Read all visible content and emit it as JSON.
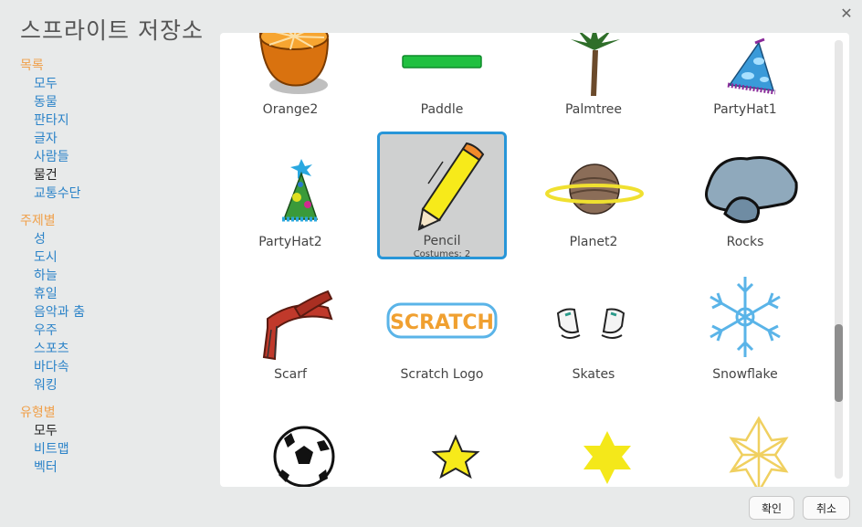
{
  "dialog": {
    "title": "스프라이트 저장소",
    "close_glyph": "✕"
  },
  "sidebar": {
    "category_header": "목록",
    "category_items": [
      "모두",
      "동물",
      "판타지",
      "글자",
      "사람들",
      "물건",
      "교통수단"
    ],
    "theme_header": "주제별",
    "theme_items": [
      "성",
      "도시",
      "하늘",
      "휴일",
      "음악과 춤",
      "우주",
      "스포츠",
      "바다속",
      "워킹"
    ],
    "type_header": "유형별",
    "type_items": [
      "모두",
      "비트맵",
      "벡터"
    ],
    "selected_category": "물건",
    "selected_type": "모두"
  },
  "sprites": [
    {
      "name": "Orange2",
      "icon": "orange-icon"
    },
    {
      "name": "Paddle",
      "icon": "paddle-icon"
    },
    {
      "name": "Palmtree",
      "icon": "palmtree-icon"
    },
    {
      "name": "PartyHat1",
      "icon": "party-hat-icon"
    },
    {
      "name": "PartyHat2",
      "icon": "party-hat-icon"
    },
    {
      "name": "Pencil",
      "icon": "pencil-icon",
      "costumes": "Costumes: 2",
      "selected": true
    },
    {
      "name": "Planet2",
      "icon": "planet-icon"
    },
    {
      "name": "Rocks",
      "icon": "rocks-icon"
    },
    {
      "name": "Scarf",
      "icon": "scarf-icon"
    },
    {
      "name": "Scratch Logo",
      "icon": "scratch-logo-icon"
    },
    {
      "name": "Skates",
      "icon": "skates-icon"
    },
    {
      "name": "Snowflake",
      "icon": "snowflake-icon"
    },
    {
      "name": "",
      "icon": "soccer-ball-icon"
    },
    {
      "name": "",
      "icon": "star-icon"
    },
    {
      "name": "",
      "icon": "star-icon"
    },
    {
      "name": "",
      "icon": "star-icon"
    }
  ],
  "buttons": {
    "ok": "확인",
    "cancel": "취소"
  },
  "colors": {
    "accent": "#2896d8",
    "header": "#f0a04a",
    "link": "#2b83c8"
  }
}
